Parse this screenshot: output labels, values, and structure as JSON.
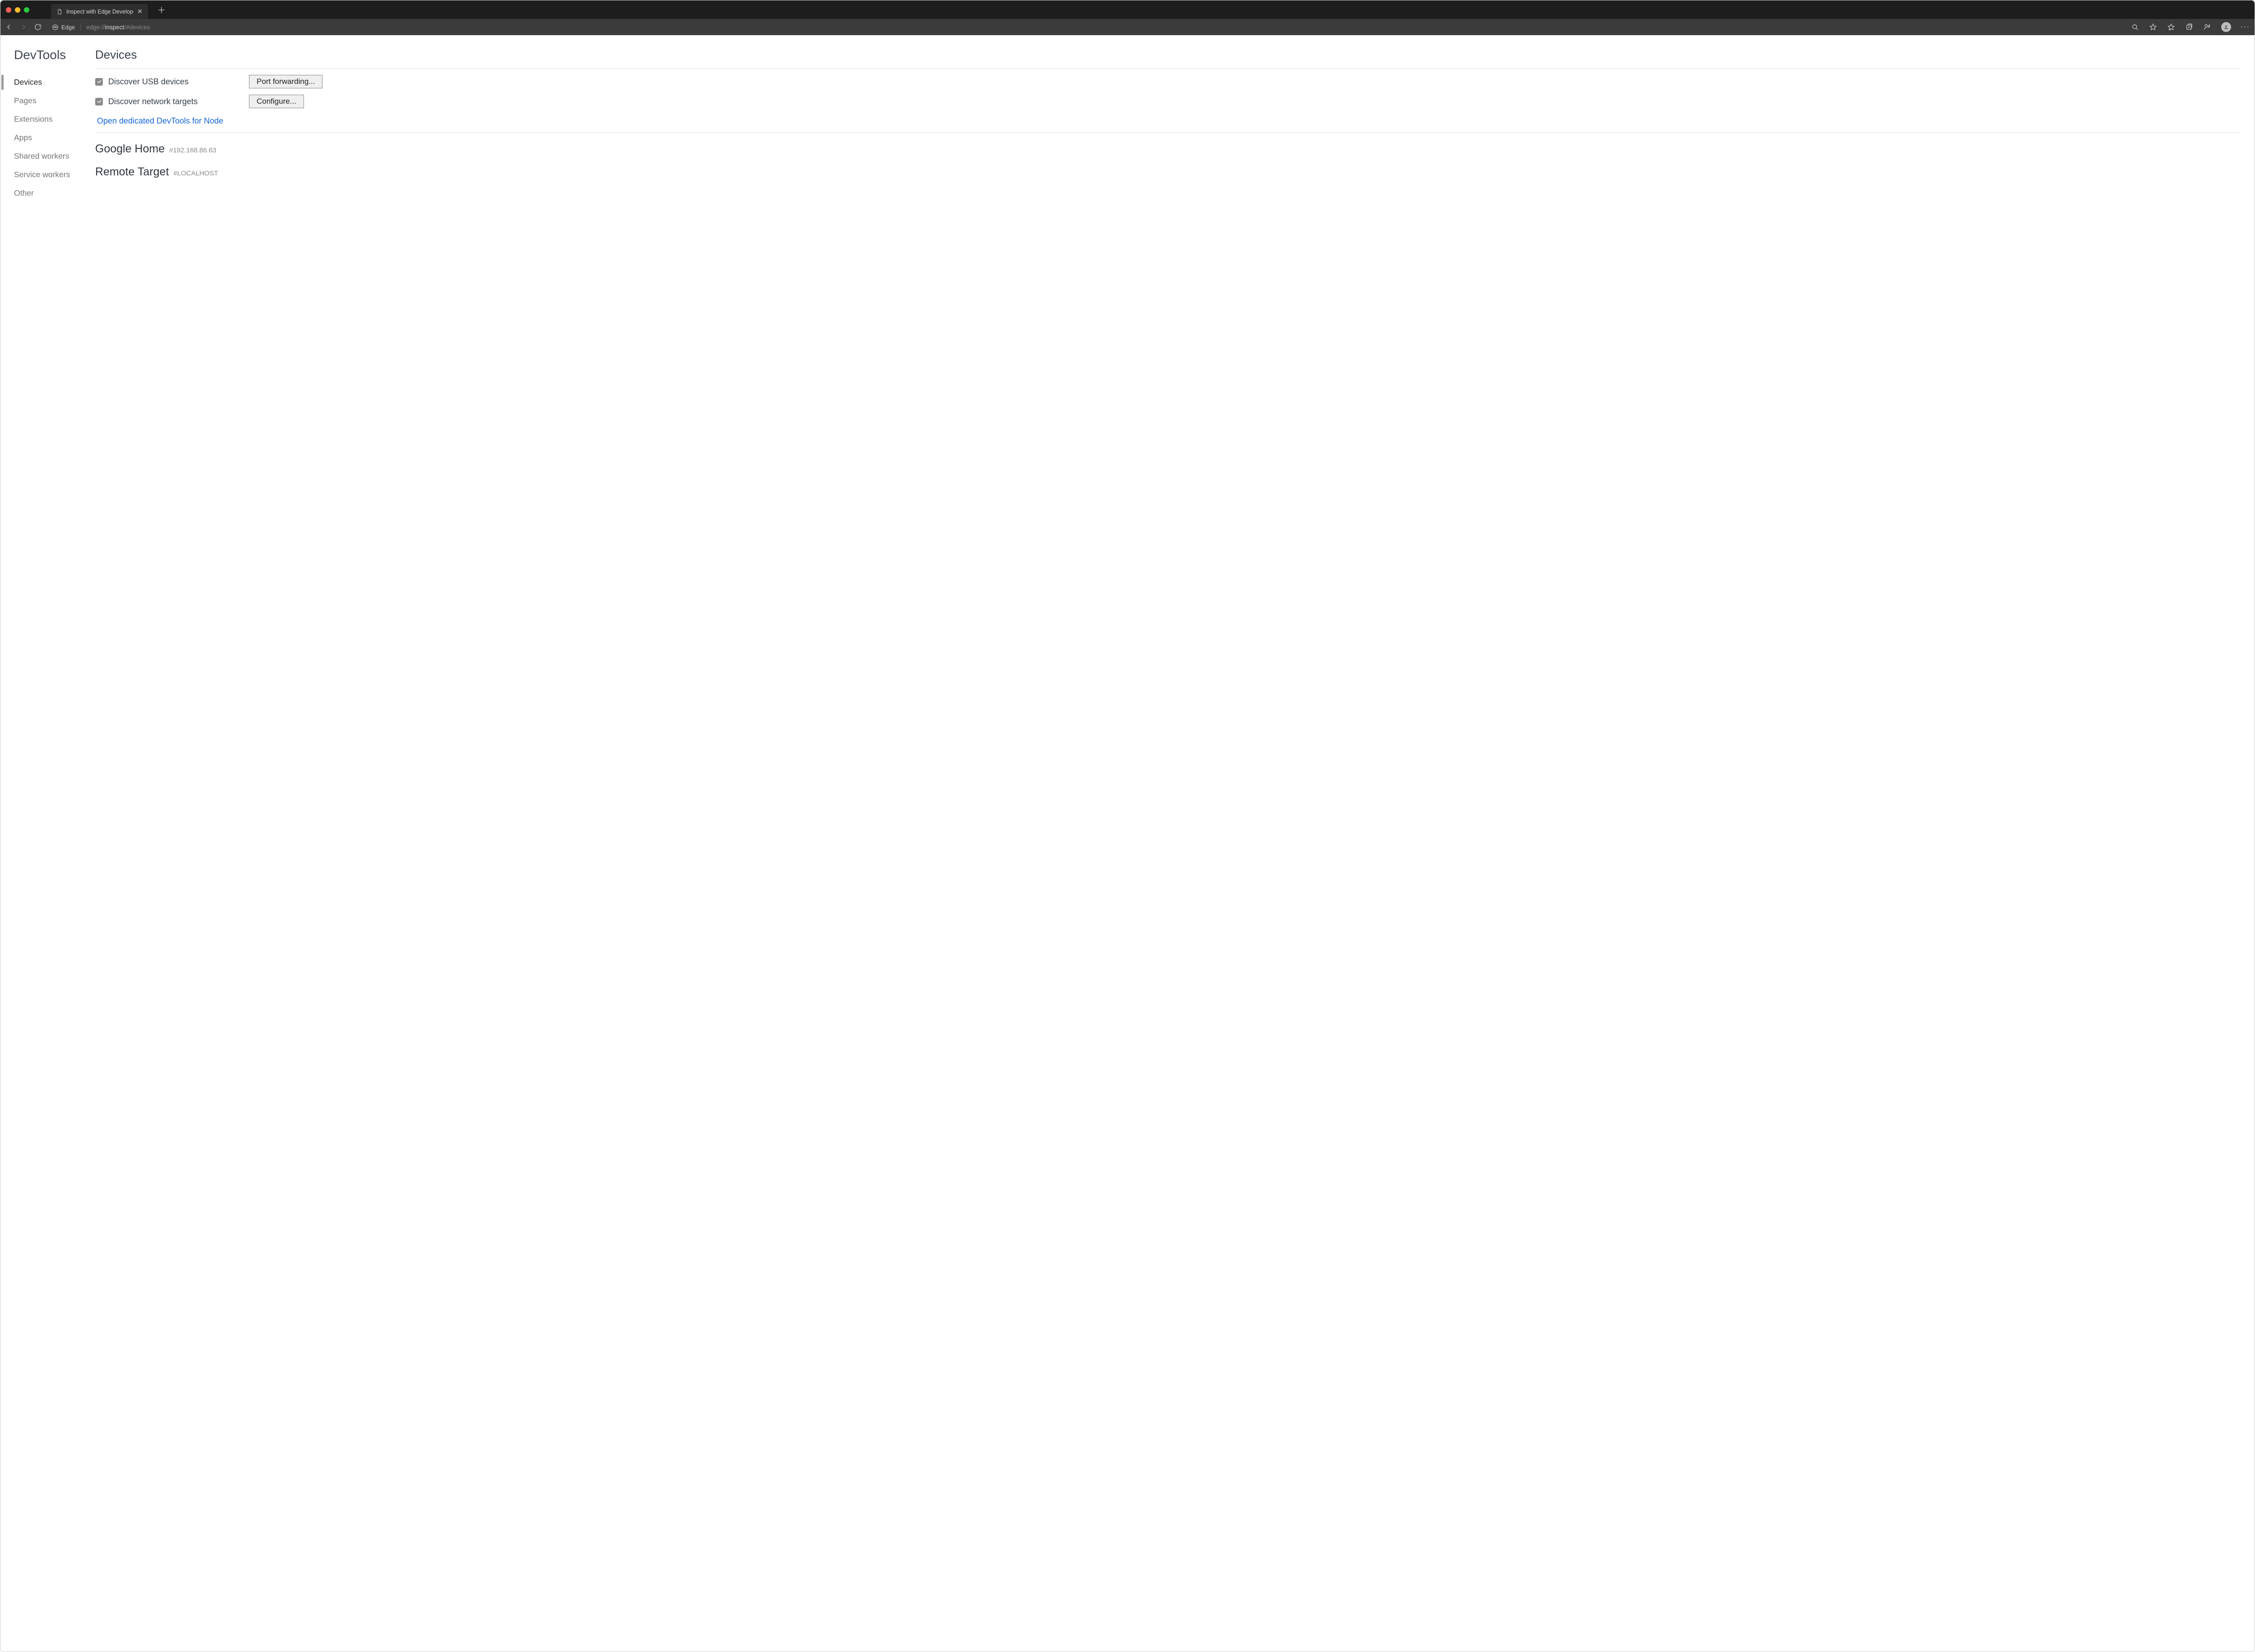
{
  "tab": {
    "title": "Inspect with Edge Developer T"
  },
  "addressbar": {
    "brand": "Edge",
    "url_prefix": "edge://",
    "url_bold": "inspect",
    "url_suffix": "/#devices"
  },
  "sidebar": {
    "title": "DevTools",
    "items": [
      {
        "label": "Devices",
        "active": true
      },
      {
        "label": "Pages",
        "active": false
      },
      {
        "label": "Extensions",
        "active": false
      },
      {
        "label": "Apps",
        "active": false
      },
      {
        "label": "Shared workers",
        "active": false
      },
      {
        "label": "Service workers",
        "active": false
      },
      {
        "label": "Other",
        "active": false
      }
    ]
  },
  "main": {
    "heading": "Devices",
    "discover_usb": {
      "label": "Discover USB devices",
      "checked": true,
      "button": "Port forwarding..."
    },
    "discover_net": {
      "label": "Discover network targets",
      "checked": true,
      "button": "Configure..."
    },
    "node_link": "Open dedicated DevTools for Node",
    "targets": [
      {
        "name": "Google Home",
        "sub": "#192.168.86.63"
      },
      {
        "name": "Remote Target",
        "sub": "#LOCALHOST"
      }
    ]
  }
}
